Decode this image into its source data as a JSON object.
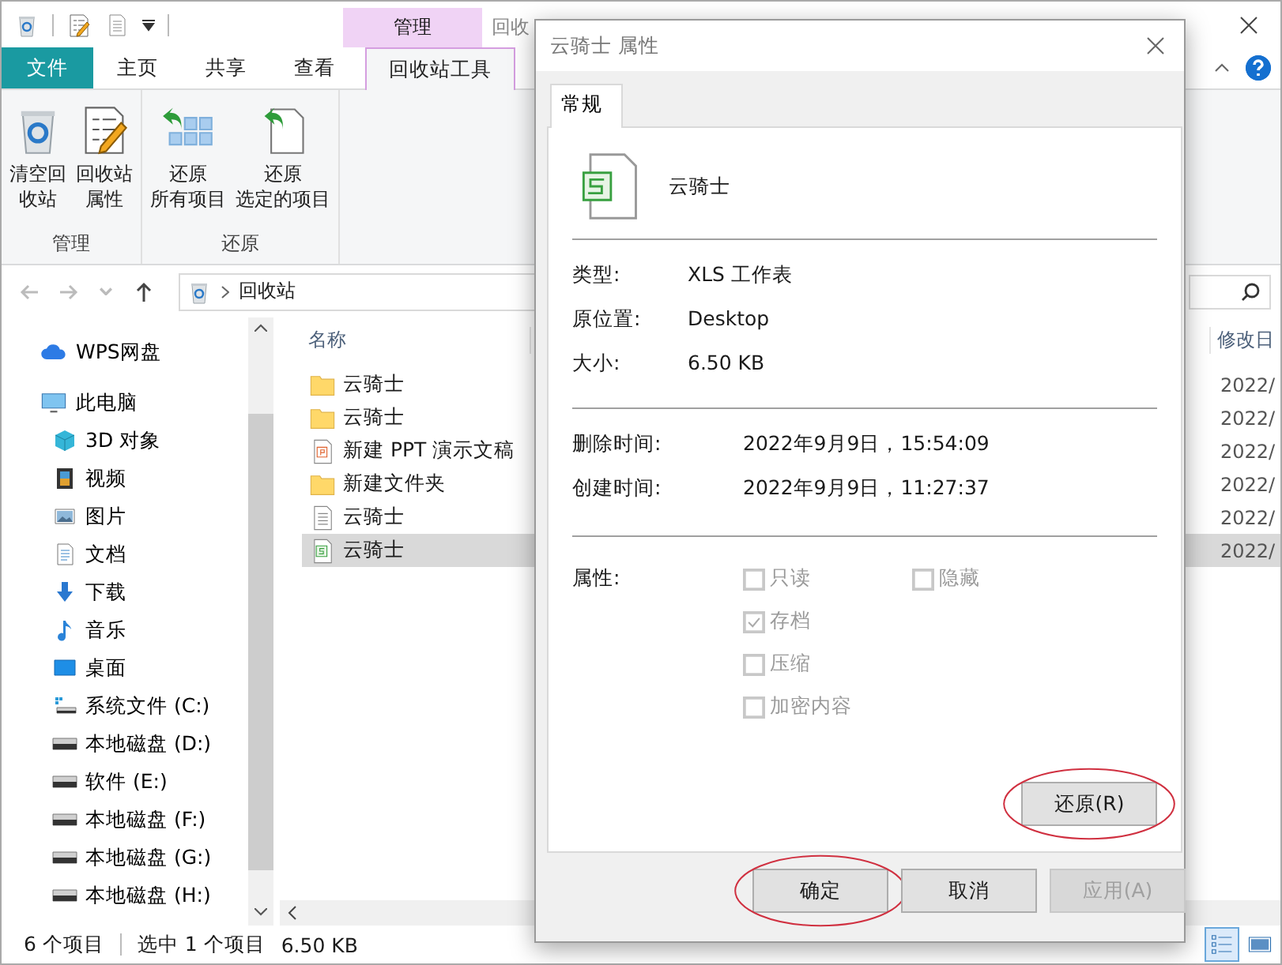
{
  "explorer": {
    "title": "回收",
    "context_group": "管理",
    "ribbon_tabs": [
      {
        "label": "文件",
        "kind": "file",
        "selected": false
      },
      {
        "label": "主页",
        "kind": "tab",
        "selected": false
      },
      {
        "label": "共享",
        "kind": "tab",
        "selected": false
      },
      {
        "label": "查看",
        "kind": "tab",
        "selected": false
      },
      {
        "label": "回收站工具",
        "kind": "tab",
        "selected": true
      }
    ],
    "ribbon_groups": [
      {
        "label": "管理",
        "buttons": [
          {
            "lines": [
              "清空回",
              "收站"
            ],
            "kind": "recycle"
          },
          {
            "lines": [
              "回收站",
              "属性"
            ],
            "kind": "properties"
          }
        ]
      },
      {
        "label": "还原",
        "buttons": [
          {
            "lines": [
              "还原",
              "所有项目"
            ],
            "kind": "restore-all"
          },
          {
            "lines": [
              "还原",
              "选定的项目"
            ],
            "kind": "restore-one"
          }
        ]
      }
    ],
    "address": "回收站",
    "nav": [
      {
        "label": "WPS网盘",
        "kind": "cloud"
      },
      {
        "label": "此电脑",
        "kind": "pc",
        "children": [
          {
            "label": "3D 对象",
            "kind": "cube"
          },
          {
            "label": "视频",
            "kind": "film"
          },
          {
            "label": "图片",
            "kind": "image"
          },
          {
            "label": "文档",
            "kind": "doc"
          },
          {
            "label": "下载",
            "kind": "download"
          },
          {
            "label": "音乐",
            "kind": "music"
          },
          {
            "label": "桌面",
            "kind": "desktop"
          },
          {
            "label": "系统文件 (C:)",
            "kind": "sysdrive"
          },
          {
            "label": "本地磁盘 (D:)",
            "kind": "drive"
          },
          {
            "label": "软件 (E:)",
            "kind": "drive"
          },
          {
            "label": "本地磁盘 (F:)",
            "kind": "drive"
          },
          {
            "label": "本地磁盘 (G:)",
            "kind": "drive"
          },
          {
            "label": "本地磁盘 (H:)",
            "kind": "drive"
          }
        ]
      }
    ],
    "columns": [
      "名称",
      "修改日"
    ],
    "files": [
      {
        "name": "云骑士",
        "kind": "folder",
        "date": "2022/",
        "selected": false
      },
      {
        "name": "云骑士",
        "kind": "folder",
        "date": "2022/",
        "selected": false
      },
      {
        "name": "新建 PPT 演示文稿",
        "kind": "ppt",
        "date": "2022/",
        "selected": false
      },
      {
        "name": "新建文件夹",
        "kind": "folder",
        "date": "2022/",
        "selected": false
      },
      {
        "name": "云骑士",
        "kind": "text",
        "date": "2022/",
        "selected": false
      },
      {
        "name": "云骑士",
        "kind": "sheet",
        "date": "2022/",
        "selected": true
      }
    ],
    "status": {
      "count": "6 个项目",
      "selection": "选中 1 个项目",
      "size": "6.50 KB"
    },
    "view_buttons": [
      {
        "kind": "details",
        "selected": true
      },
      {
        "kind": "thumbnails",
        "selected": false
      }
    ]
  },
  "dialog": {
    "title": "云骑士 属性",
    "tabs": [
      {
        "label": "常规",
        "selected": true
      }
    ],
    "file_name": "云骑士",
    "info": [
      {
        "label": "类型:",
        "value": "XLS 工作表"
      },
      {
        "label": "原位置:",
        "value": "Desktop"
      },
      {
        "label": "大小:",
        "value": "6.50 KB"
      }
    ],
    "times": [
      {
        "label": "删除时间:",
        "value": "2022年9月9日，15:54:09"
      },
      {
        "label": "创建时间:",
        "value": "2022年9月9日，11:27:37"
      }
    ],
    "attributes_label": "属性:",
    "attributes": [
      {
        "label": "只读",
        "checked": false,
        "disabled": true
      },
      {
        "label": "隐藏",
        "checked": false,
        "disabled": true
      },
      {
        "label": "存档",
        "checked": true,
        "disabled": true
      },
      {
        "label": "压缩",
        "checked": false,
        "disabled": true
      },
      {
        "label": "加密内容",
        "checked": false,
        "disabled": true
      }
    ],
    "restore_button": {
      "label": "还原(R)",
      "highlighted": true
    },
    "buttons": [
      {
        "label": "确定",
        "disabled": false,
        "highlighted": true
      },
      {
        "label": "取消",
        "disabled": false,
        "highlighted": false
      },
      {
        "label": "应用(A)",
        "disabled": true,
        "highlighted": false
      }
    ]
  }
}
